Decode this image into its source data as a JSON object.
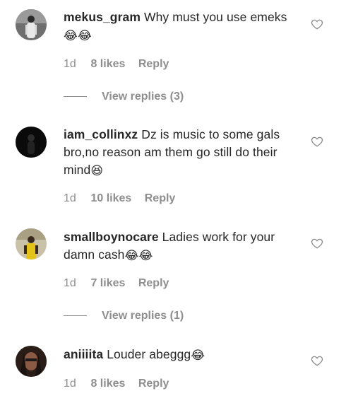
{
  "comments": [
    {
      "username": "mekus_gram",
      "text": "Why must you use emeks",
      "emojis": "😂😂",
      "time": "1d",
      "likes": "8 likes",
      "reply": "Reply",
      "view_replies": "View replies (3)"
    },
    {
      "username": "iam_collinxz",
      "text": "Dz is music to some gals bro,no reason am them go still do their mind",
      "emojis": "😆",
      "time": "1d",
      "likes": "10 likes",
      "reply": "Reply"
    },
    {
      "username": "smallboynocare",
      "text": "Ladies work for your damn cash",
      "emojis": "😂😂",
      "time": "1d",
      "likes": "7 likes",
      "reply": "Reply",
      "view_replies": "View replies (1)"
    },
    {
      "username": "aniiiita",
      "text": "Louder abeggg",
      "emojis": "😂",
      "time": "1d",
      "likes": "8 likes",
      "reply": "Reply"
    }
  ],
  "icons": {
    "like": "heart-outline-icon"
  },
  "colors": {
    "text": "#262626",
    "muted": "#8e8e8e"
  }
}
